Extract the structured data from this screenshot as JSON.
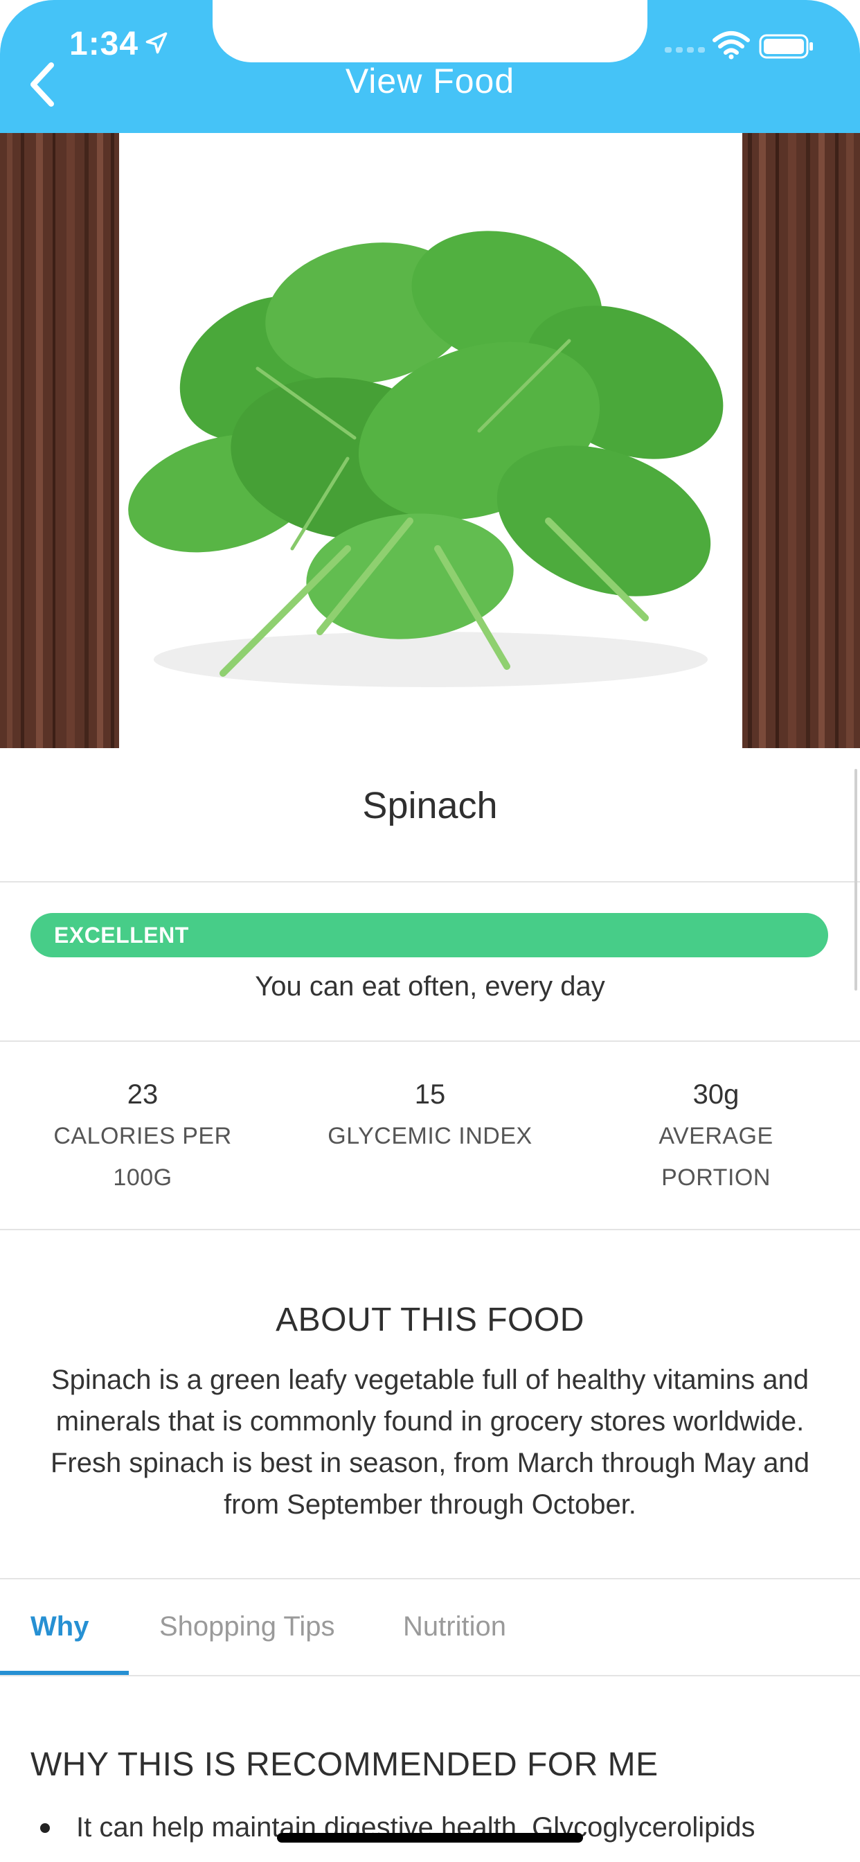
{
  "status_bar": {
    "time": "1:34"
  },
  "header": {
    "title": "View Food",
    "back_icon": "chevron-left-icon"
  },
  "food": {
    "name": "Spinach",
    "image": "spinach-photo"
  },
  "rating": {
    "label": "EXCELLENT",
    "description": "You can eat often, every day",
    "color": "#47cd88"
  },
  "stats": [
    {
      "value": "23",
      "label_line1": "CALORIES PER",
      "label_line2": "100G"
    },
    {
      "value": "15",
      "label_line1": "GLYCEMIC INDEX",
      "label_line2": ""
    },
    {
      "value": "30g",
      "label_line1": "AVERAGE",
      "label_line2": "PORTION"
    }
  ],
  "about": {
    "title": "ABOUT THIS FOOD",
    "text": "Spinach is a green leafy vegetable full of healthy vitamins and minerals that is commonly found in grocery stores worldwide. Fresh spinach is best in season, from March through May and from September through October."
  },
  "tabs": [
    {
      "label": "Why",
      "active": true
    },
    {
      "label": "Shopping Tips",
      "active": false
    },
    {
      "label": "Nutrition",
      "active": false
    }
  ],
  "why": {
    "title": "WHY THIS IS RECOMMENDED FOR ME",
    "items": [
      "It can help maintain digestive health. Glycoglycerolipids"
    ]
  },
  "colors": {
    "header": "#45c3f7",
    "accent": "#2690d3"
  }
}
